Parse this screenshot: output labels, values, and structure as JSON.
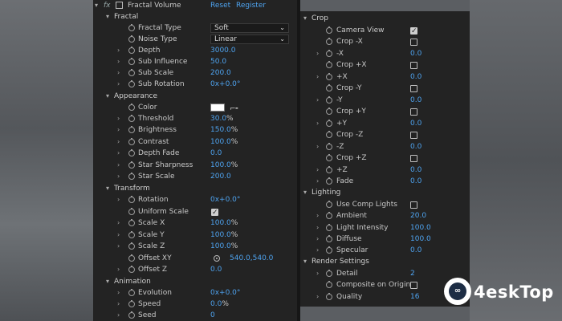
{
  "header": {
    "effect_name": "Fractal Volume",
    "reset": "Reset",
    "register": "Register",
    "fx": "fx"
  },
  "left": {
    "fractal": {
      "title": "Fractal",
      "fractal_type": {
        "label": "Fractal Type",
        "value": "Soft"
      },
      "noise_type": {
        "label": "Noise Type",
        "value": "Linear"
      },
      "depth": {
        "label": "Depth",
        "value": "3000.0"
      },
      "sub_influence": {
        "label": "Sub Influence",
        "value": "50.0"
      },
      "sub_scale": {
        "label": "Sub Scale",
        "value": "200.0"
      },
      "sub_rotation": {
        "label": "Sub Rotation",
        "value": "0x+0.0°"
      }
    },
    "appearance": {
      "title": "Appearance",
      "color": {
        "label": "Color",
        "value": "#ffffff"
      },
      "threshold": {
        "label": "Threshold",
        "value": "30.0",
        "unit": "%"
      },
      "brightness": {
        "label": "Brightness",
        "value": "150.0",
        "unit": "%"
      },
      "contrast": {
        "label": "Contrast",
        "value": "100.0",
        "unit": "%"
      },
      "depth_fade": {
        "label": "Depth Fade",
        "value": "0.0"
      },
      "star_sharpness": {
        "label": "Star Sharpness",
        "value": "100.0",
        "unit": "%"
      },
      "star_scale": {
        "label": "Star Scale",
        "value": "200.0"
      }
    },
    "transform": {
      "title": "Transform",
      "rotation": {
        "label": "Rotation",
        "value": "0x+0.0°"
      },
      "uniform_scale": {
        "label": "Uniform Scale",
        "checked": true
      },
      "scale_x": {
        "label": "Scale X",
        "value": "100.0",
        "unit": "%"
      },
      "scale_y": {
        "label": "Scale Y",
        "value": "100.0",
        "unit": "%"
      },
      "scale_z": {
        "label": "Scale Z",
        "value": "100.0",
        "unit": "%"
      },
      "offset_xy": {
        "label": "Offset XY",
        "value": "540.0,540.0"
      },
      "offset_z": {
        "label": "Offset Z",
        "value": "0.0"
      }
    },
    "animation": {
      "title": "Animation",
      "evolution": {
        "label": "Evolution",
        "value": "0x+0.0°"
      },
      "speed": {
        "label": "Speed",
        "value": "0.0",
        "unit": "%"
      },
      "seed": {
        "label": "Seed",
        "value": "0"
      }
    }
  },
  "right": {
    "crop": {
      "title": "Crop",
      "camera_view": {
        "label": "Camera View",
        "checked": true
      },
      "crop_neg_x": {
        "label": "Crop -X",
        "checked": false
      },
      "neg_x": {
        "label": "-X",
        "value": "0.0"
      },
      "crop_pos_x": {
        "label": "Crop +X",
        "checked": false
      },
      "pos_x": {
        "label": "+X",
        "value": "0.0"
      },
      "crop_neg_y": {
        "label": "Crop -Y",
        "checked": false
      },
      "neg_y": {
        "label": "-Y",
        "value": "0.0"
      },
      "crop_pos_y": {
        "label": "Crop +Y",
        "checked": false
      },
      "pos_y": {
        "label": "+Y",
        "value": "0.0"
      },
      "crop_neg_z": {
        "label": "Crop -Z",
        "checked": false
      },
      "neg_z": {
        "label": "-Z",
        "value": "0.0"
      },
      "crop_pos_z": {
        "label": "Crop +Z",
        "checked": false
      },
      "pos_z": {
        "label": "+Z",
        "value": "0.0"
      },
      "fade": {
        "label": "Fade",
        "value": "0.0"
      }
    },
    "lighting": {
      "title": "Lighting",
      "use_comp_lights": {
        "label": "Use Comp Lights",
        "checked": false
      },
      "ambient": {
        "label": "Ambient",
        "value": "20.0"
      },
      "light_intensity": {
        "label": "Light Intensity",
        "value": "100.0"
      },
      "diffuse": {
        "label": "Diffuse",
        "value": "100.0"
      },
      "specular": {
        "label": "Specular",
        "value": "0.0"
      }
    },
    "render": {
      "title": "Render Settings",
      "detail": {
        "label": "Detail",
        "value": "2"
      },
      "composite_on_origin": {
        "label": "Composite on Origin",
        "checked": false
      },
      "quality": {
        "label": "Quality",
        "value": "16"
      }
    }
  },
  "watermark": {
    "text": "4eskTop"
  },
  "colors": {
    "panel": "#232323",
    "value_blue": "#4ea3ef",
    "text": "#c8c8c8"
  }
}
